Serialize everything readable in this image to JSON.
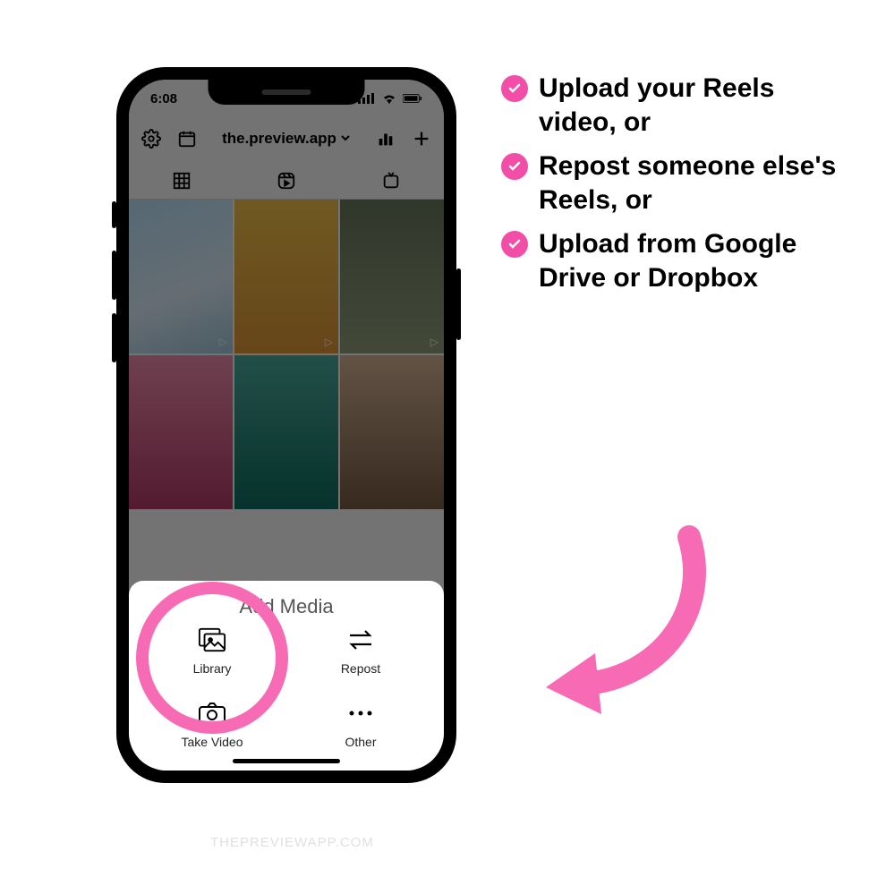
{
  "statusbar": {
    "time": "6:08"
  },
  "toolbar": {
    "title": "the.preview.app"
  },
  "sheet": {
    "title": "Add Media",
    "items": [
      "Library",
      "Repost",
      "Take Video",
      "Other"
    ]
  },
  "bullets": [
    "Upload your Reels video, or",
    "Repost someone else's Reels, or",
    "Upload from Google Drive or Dropbox"
  ],
  "watermark": "THEPREVIEWAPP.COM",
  "accent": "#f24ea8"
}
